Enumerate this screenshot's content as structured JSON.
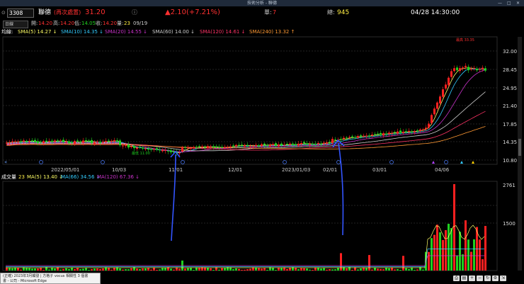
{
  "window": {
    "title": "技術分析 - 聯德",
    "min": "—",
    "max": "□",
    "close": "✕"
  },
  "quote": {
    "code": "3308",
    "name": "聯德",
    "note": "(再次處置)",
    "price": "31.20",
    "info_icon": "ⓘ",
    "change": "▲2.10(+7.21%)",
    "vol_label": "單:",
    "vol_value": "7",
    "total_label": "總:",
    "total_value": "945",
    "datetime": "04/28 14:30:00"
  },
  "ohlc": {
    "period": "日線",
    "open_label": "開:",
    "open": "14.20",
    "high_label": "高:",
    "high": "14.20",
    "low_label": "低:",
    "low": "14.05",
    "close_label": "收:",
    "close": "14.20",
    "vol_label": "量:",
    "vol": "23",
    "date": "09/19"
  },
  "ma": {
    "label": "均線:",
    "items": [
      {
        "text": "SMA(5) 14.27 ↓",
        "color": "#ffff66"
      },
      {
        "text": "SMA(10) 14.35 ↓",
        "color": "#33ccff"
      },
      {
        "text": "SMA(20) 14.55 ↓",
        "color": "#cc33cc"
      },
      {
        "text": "SMA(60) 14.00 ↓",
        "color": "#cccccc"
      },
      {
        "text": "SMA(120) 14.61 ↓",
        "color": "#ff3366"
      },
      {
        "text": "SMA(240) 13.32 ↑",
        "color": "#ff9933"
      }
    ]
  },
  "price_axis": [
    "32.00",
    "28.45",
    "24.95",
    "21.40",
    "17.85",
    "14.35",
    "10.80"
  ],
  "date_axis": [
    "2022/05/01",
    "10/03",
    "11/01",
    "12/01",
    "2023/01/03",
    "02/01",
    "03/01",
    "04/06"
  ],
  "annotations": {
    "low_label": "最低 11.00",
    "high_label": "最高 33.35"
  },
  "volume": {
    "label": "成交量",
    "value": "23",
    "items": [
      {
        "text": "MA(5) 13.40 ↓",
        "color": "#ffff66"
      },
      {
        "text": "MA(66) 34.56 ↓",
        "color": "#33ccff"
      },
      {
        "text": "MA(120) 67.36 ↓",
        "color": "#cc33cc"
      }
    ],
    "axis": [
      "2761",
      "1500"
    ]
  },
  "popup": {
    "line1": "(正確) 2023年3月觸發 | 方格子 vocus 相關性 3 個書",
    "line2": "書 - 公司 - Microsoft Edge"
  },
  "colors": {
    "up": "#ff2020",
    "down": "#20d020",
    "bg": "#000000"
  }
}
